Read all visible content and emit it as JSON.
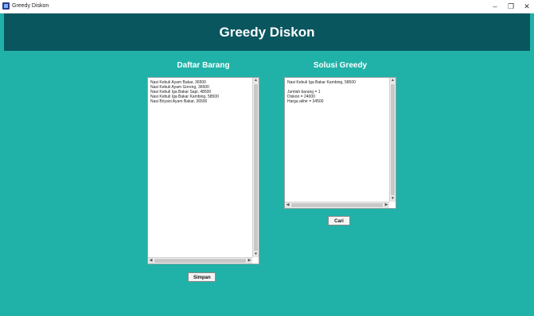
{
  "window": {
    "title": "Greedy Diskon",
    "controls": {
      "minimize": "–",
      "maximize": "❐",
      "close": "✕"
    }
  },
  "header": {
    "title": "Greedy Diskon",
    "bg_color": "#0a565f"
  },
  "colors": {
    "background": "#20b2a8",
    "header": "#0a565f"
  },
  "left": {
    "title": "Daftar Barang",
    "items": [
      "Nasi Kebuli Ayam Bakar, 36500",
      "Nasi Kebuli Ayam Goreng, 36500",
      "Nasi Kebuli Iga Bakar Sapi, 48500",
      "Nasi Kebuli Iga Bakar Kambing, 58500",
      "Nasi Briyani Ayam Bakar, 36500"
    ],
    "button_label": "Simpan"
  },
  "right": {
    "title": "Solusi Greedy",
    "lines": [
      "Nasi Kebuli Iga Bakar Kambing, 58500",
      "",
      "Jumlah barang = 1",
      "Diskon = 24000",
      "Harga akhir = 34500"
    ],
    "button_label": "Cari"
  },
  "icons": {
    "app": "app-icon",
    "scroll_up": "▲",
    "scroll_down": "▼",
    "scroll_left": "◀",
    "scroll_right": "▶"
  }
}
